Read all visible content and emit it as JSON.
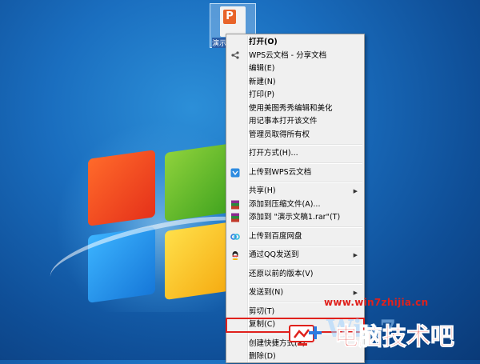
{
  "desktop": {
    "icon": {
      "label": "演示文稿1",
      "glyph": "P",
      "icon_name": "wps-presentation-icon"
    }
  },
  "context_menu": {
    "items": [
      {
        "label": "打开(O)",
        "bold": true,
        "icon": ""
      },
      {
        "label": "WPS云文档 - 分享文档",
        "icon": "share-icon"
      },
      {
        "label": "编辑(E)"
      },
      {
        "label": "新建(N)"
      },
      {
        "label": "打印(P)"
      },
      {
        "label": "使用美图秀秀编辑和美化"
      },
      {
        "label": "用记事本打开该文件"
      },
      {
        "label": "管理员取得所有权"
      },
      {
        "label": "打开方式(H)..."
      },
      {
        "label": "上传到WPS云文档",
        "icon": "wps-cloud-icon"
      },
      {
        "label": "共享(H)",
        "submenu": true
      },
      {
        "label": "添加到压缩文件(A)...",
        "icon": "winrar-icon"
      },
      {
        "label": "添加到 \"演示文稿1.rar\"(T)",
        "icon": "winrar-icon"
      },
      {
        "label": "上传到百度网盘",
        "icon": "baidu-netdisk-icon"
      },
      {
        "label": "通过QQ发送到",
        "icon": "qq-icon",
        "submenu": true
      },
      {
        "label": "还原以前的版本(V)"
      },
      {
        "label": "发送到(N)",
        "submenu": true
      },
      {
        "label": "剪切(T)"
      },
      {
        "label": "复制(C)",
        "highlighted": true
      },
      {
        "label": "创建快捷方式(S)"
      },
      {
        "label": "删除(D)"
      }
    ],
    "submenu_arrow": "▶",
    "highlight_color": "#e0211c"
  },
  "watermark": {
    "url": "www.win7zhijia.cn",
    "title": "电脑技术吧",
    "brand": "Win7",
    "color": "#e0211c"
  }
}
